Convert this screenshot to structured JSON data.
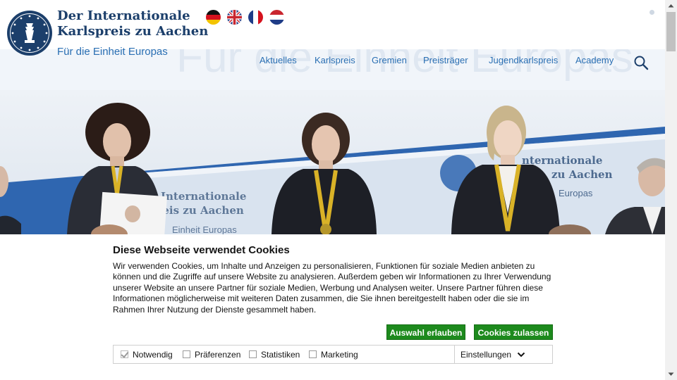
{
  "header": {
    "brand_line1": "Der Internationale",
    "brand_line2": "Karlspreis zu Aachen",
    "tagline": "Für die Einheit Europas",
    "ghost_tagline": "Für die Einheit Europas",
    "languages": [
      "de-flag-icon",
      "gb-flag-icon",
      "fr-flag-icon",
      "nl-flag-icon"
    ],
    "nav": [
      "Aktuelles",
      "Karlspreis",
      "Gremien",
      "Preisträger",
      "Jugendkarlspreis",
      "Academy"
    ]
  },
  "hero": {
    "backdrop_text_left": [
      "Internationale",
      "preis zu Aachen",
      "Einheit Europas"
    ],
    "backdrop_text_right": [
      "nternationale",
      "zu Aachen",
      "Europas"
    ]
  },
  "cookie": {
    "title": "Diese Webseite verwendet Cookies",
    "text": "Wir verwenden Cookies, um Inhalte und Anzeigen zu personalisieren, Funktionen für soziale Medien anbieten zu können und die Zugriffe auf unsere Website zu analysieren. Außerdem geben wir Informationen zu Ihrer Verwendung unserer Website an unsere Partner für soziale Medien, Werbung und Analysen weiter. Unsere Partner führen diese Informationen möglicherweise mit weiteren Daten zusammen, die Sie ihnen bereitgestellt haben oder die sie im Rahmen Ihrer Nutzung der Dienste gesammelt haben.",
    "btn_select": "Auswahl erlauben",
    "btn_all": "Cookies zulassen",
    "categories": [
      {
        "label": "Notwendig",
        "checked": true,
        "disabled": true
      },
      {
        "label": "Präferenzen",
        "checked": false
      },
      {
        "label": "Statistiken",
        "checked": false
      },
      {
        "label": "Marketing",
        "checked": false
      }
    ],
    "settings_label": "Einstellungen"
  },
  "colors": {
    "brand_navy": "#1c3f6b",
    "link_blue": "#2a6fb3",
    "button_green": "#1d8a1d"
  }
}
